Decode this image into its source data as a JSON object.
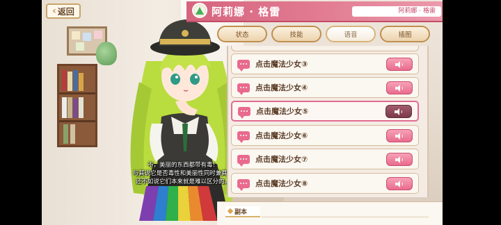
{
  "header": {
    "back_label": "返回",
    "character_name": "阿莉娜 · 格雷",
    "name_tag": "阿莉娜 · 格雷"
  },
  "tabs": [
    {
      "label": "状态",
      "active": false
    },
    {
      "label": "技能",
      "active": false
    },
    {
      "label": "语音",
      "active": true
    },
    {
      "label": "插图",
      "active": false
    }
  ],
  "voice_list": [
    {
      "label": "点击魔法少女③",
      "selected": false
    },
    {
      "label": "点击魔法少女④",
      "selected": false
    },
    {
      "label": "点击魔法少女⑤",
      "selected": true
    },
    {
      "label": "点击魔法少女⑥",
      "selected": false
    },
    {
      "label": "点击魔法少女⑦",
      "selected": false
    },
    {
      "label": "点击魔法少女⑧",
      "selected": false
    }
  ],
  "caption": {
    "line1": "不，美丽的东西都带有毒！",
    "line2": "与其说它是否毒性和美丽性同时兼具，",
    "line3": "还不如说它们本来就是难以区分的。"
  },
  "section": {
    "title": "副本"
  },
  "colors": {
    "accent_pink": "#e96a8e",
    "name_bar": "#d6647e",
    "tab_border": "#bf8f4f",
    "hair_green": "#b9dc3e"
  },
  "icons": {
    "back": "chevron-left-icon",
    "emblem": "green-gem-icon",
    "voice_bubble": "speech-bubble-icon",
    "play": "speaker-icon"
  }
}
